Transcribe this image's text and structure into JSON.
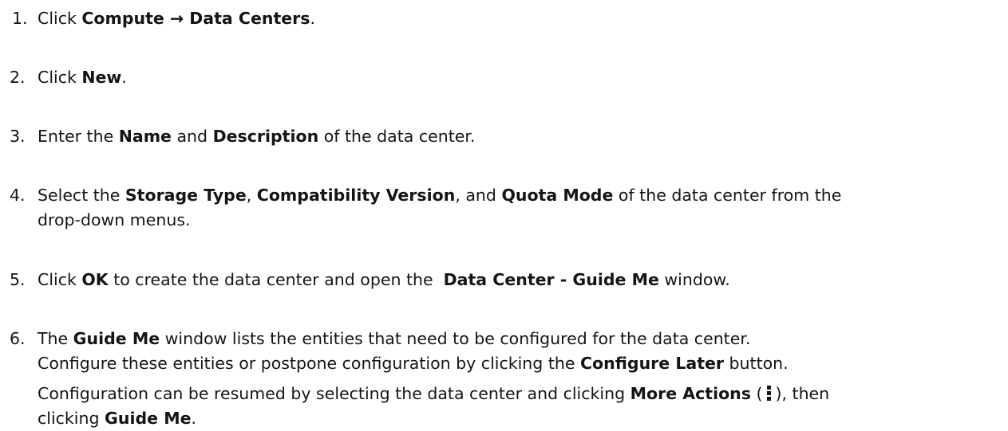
{
  "steps": [
    {
      "number": "1.",
      "lines": [
        [
          {
            "text": "Click ",
            "bold": false
          },
          {
            "text": "Compute → Data Centers",
            "bold": true
          },
          {
            "text": ".",
            "bold": false
          }
        ]
      ]
    },
    {
      "number": "2.",
      "lines": [
        [
          {
            "text": "Click ",
            "bold": false
          },
          {
            "text": "New",
            "bold": true
          },
          {
            "text": ".",
            "bold": false
          }
        ]
      ]
    },
    {
      "number": "3.",
      "lines": [
        [
          {
            "text": "Enter the ",
            "bold": false
          },
          {
            "text": "Name",
            "bold": true
          },
          {
            "text": " and ",
            "bold": false
          },
          {
            "text": "Description",
            "bold": true
          },
          {
            "text": " of the data center.",
            "bold": false
          }
        ]
      ]
    },
    {
      "number": "4.",
      "lines": [
        [
          {
            "text": "Select the ",
            "bold": false
          },
          {
            "text": "Storage Type",
            "bold": true
          },
          {
            "text": ", ",
            "bold": false
          },
          {
            "text": "Compatibility Version",
            "bold": true
          },
          {
            "text": ", and ",
            "bold": false
          },
          {
            "text": "Quota Mode",
            "bold": true
          },
          {
            "text": " of the data center from the",
            "bold": false
          }
        ],
        [
          {
            "text": "drop-down menus.",
            "bold": false
          }
        ]
      ]
    },
    {
      "number": "5.",
      "lines": [
        [
          {
            "text": "Click ",
            "bold": false
          },
          {
            "text": "OK",
            "bold": true
          },
          {
            "text": " to create the data center and open the  ",
            "bold": false
          },
          {
            "text": "Data Center - Guide Me",
            "bold": true
          },
          {
            "text": " window.",
            "bold": false
          }
        ]
      ]
    },
    {
      "number": "6.",
      "lines": [
        [
          {
            "text": "The ",
            "bold": false
          },
          {
            "text": "Guide Me",
            "bold": true
          },
          {
            "text": " window lists the entities that need to be configured for the data center.",
            "bold": false
          }
        ],
        [
          {
            "text": "Configure these entities or postpone configuration by clicking the ",
            "bold": false
          },
          {
            "text": "Configure Later",
            "bold": true
          },
          {
            "text": " button.",
            "bold": false
          }
        ],
        [
          {
            "text": "Configuration can be resumed by selecting the data center and clicking ",
            "bold": false
          },
          {
            "text": "More Actions",
            "bold": true
          },
          {
            "text": " (",
            "bold": false
          },
          {
            "icon": "kebab-icon"
          },
          {
            "text": "), then",
            "bold": false
          }
        ],
        [
          {
            "text": "clicking ",
            "bold": false
          },
          {
            "text": "Guide Me",
            "bold": true
          },
          {
            "text": ".",
            "bold": false
          }
        ]
      ]
    }
  ]
}
